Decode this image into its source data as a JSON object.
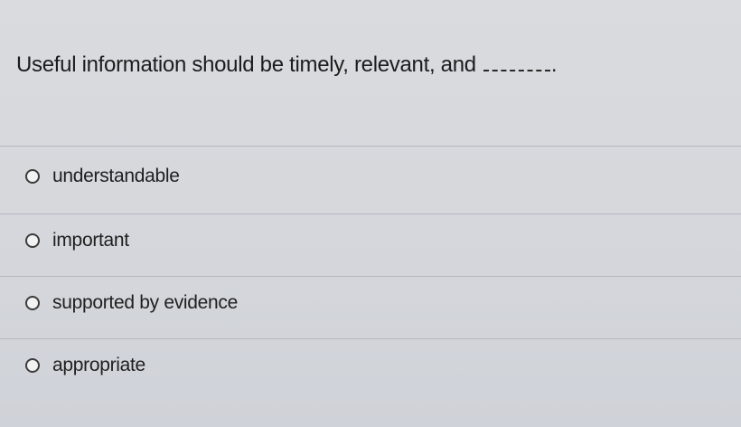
{
  "question": {
    "text": "Useful information should be timely, relevant, and",
    "period": "."
  },
  "options": [
    {
      "label": "understandable",
      "selected": false
    },
    {
      "label": "important",
      "selected": false
    },
    {
      "label": "supported by evidence",
      "selected": false
    },
    {
      "label": "appropriate",
      "selected": false
    }
  ]
}
